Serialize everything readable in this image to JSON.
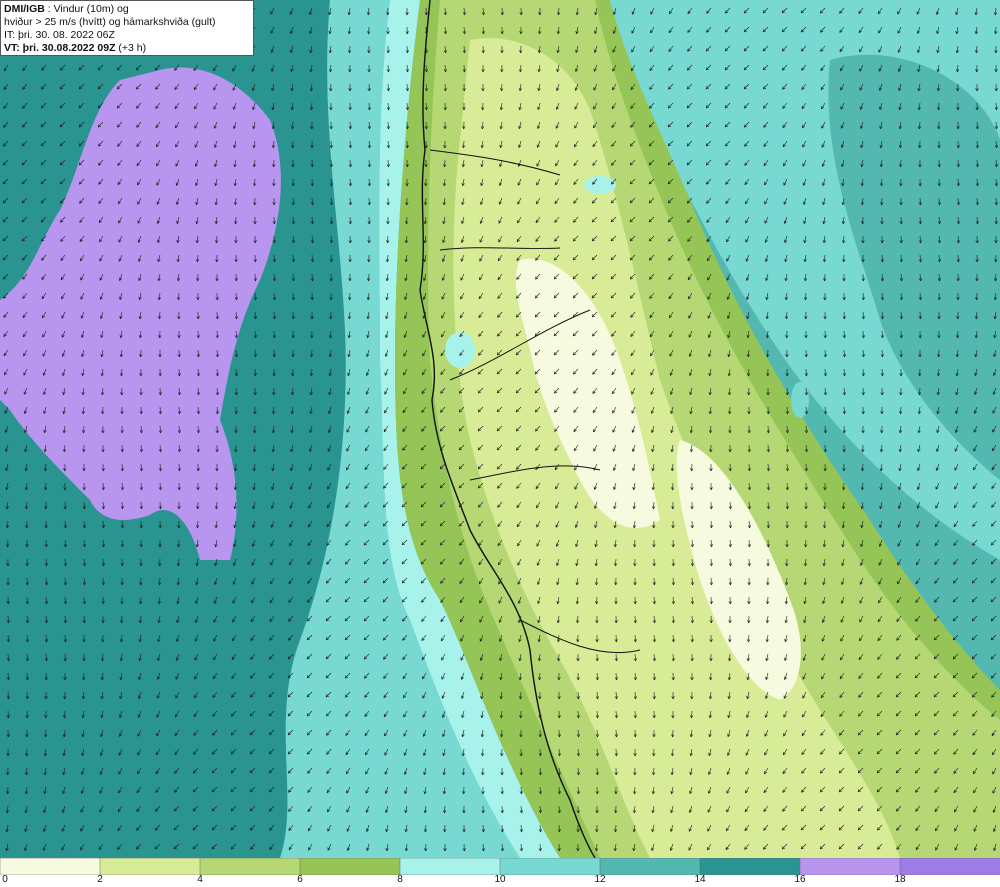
{
  "header": {
    "source_label": "DMI/IGB",
    "title_rest": " : Vindur (10m) og",
    "line2": "hviður > 25 m/s (hvítt) og hámarkshviða (gult)",
    "issue_time": "IT: þri. 30. 08. 2022 06Z",
    "valid_prefix": "VT: þri. 30.08.2022 09Z",
    "valid_suffix": " (+3 h)"
  },
  "legend": {
    "ticks": [
      "0",
      "2",
      "4",
      "6",
      "8",
      "10",
      "12",
      "14",
      "16",
      "18"
    ],
    "colors": [
      "#f6fbe0",
      "#d8ec98",
      "#b5d874",
      "#95c556",
      "#a8f2ec",
      "#78d8d2",
      "#52b8b0",
      "#2a9590",
      "#b896f0",
      "#9e7ce8"
    ]
  },
  "map": {
    "colors": {
      "deep_sea": "#2a9590",
      "sea": "#52b8b0",
      "light_sea": "#78d8d2",
      "coast_water": "#a8f2ec",
      "calm_land": "#f6fbe0",
      "low_wind": "#d8ec98",
      "mid_wind": "#b5d874",
      "strong_land": "#95c556",
      "storm": "#b896f0",
      "coastline": "#111111"
    },
    "arrow_direction": "south-southwest"
  }
}
